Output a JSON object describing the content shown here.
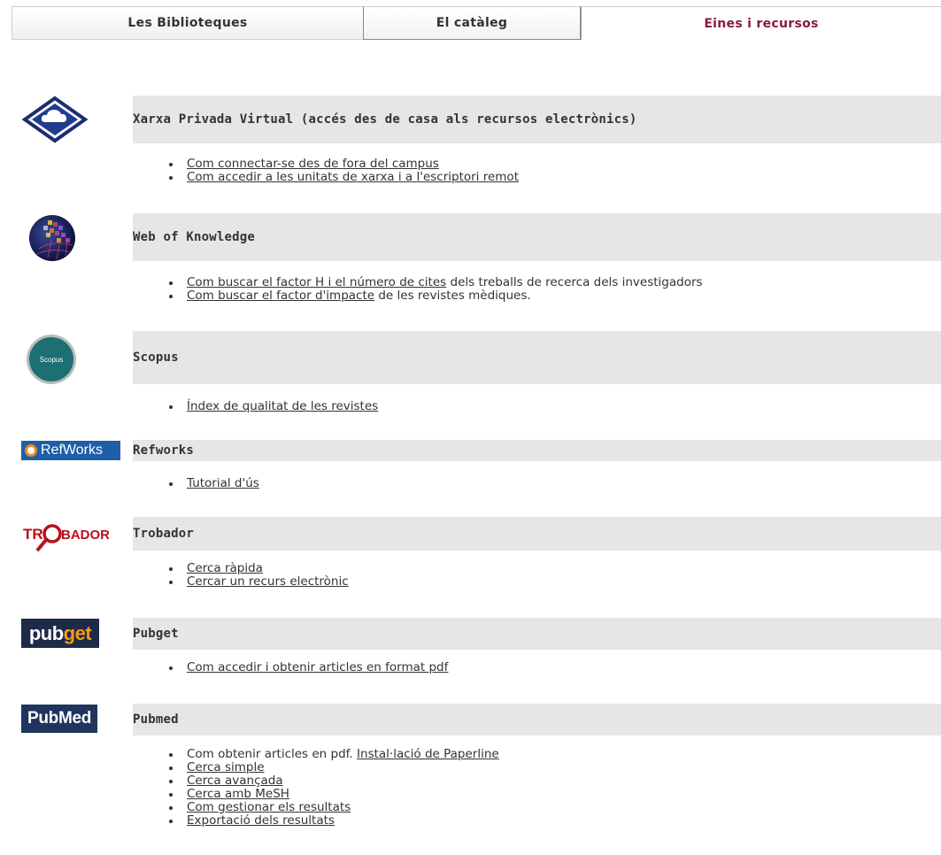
{
  "tabs": [
    {
      "label": "Les Biblioteques"
    },
    {
      "label": "El catàleg"
    },
    {
      "label": "Eines i recursos",
      "active": true
    }
  ],
  "colors": {
    "active_tab": "#8b1a3a",
    "bar_background": "#e6e6e6",
    "refworks_blue": "#1e5fa8",
    "trobador_red": "#b5121b",
    "pubget_navy": "#1d2a48",
    "pubget_orange": "#f49a1a",
    "pubmed_navy": "#20355e",
    "scopus_teal": "#1e6f73"
  },
  "sections": {
    "vpn": {
      "icon": "vpn-diamond-icon",
      "title": "Xarxa Privada Virtual (accés des de casa als recursos electrònics)",
      "items": [
        {
          "link": "Com connectar-se des de fora del campus"
        },
        {
          "link": "Com accedir a les unitats de xarxa i a l'escriptori remot"
        }
      ]
    },
    "wok": {
      "icon": "web-of-knowledge-globe-icon",
      "title": "Web of Knowledge",
      "items": [
        {
          "link": "Com buscar el factor H i el número de cites",
          "text": " dels treballs de recerca dels investigadors"
        },
        {
          "link": "Com buscar el factor d'impacte",
          "text": " de les revistes mèdiques."
        }
      ]
    },
    "scopus": {
      "icon": "scopus-logo-icon",
      "logo_text": "Scopus",
      "title": "Scopus",
      "items": [
        {
          "link": "Índex de qualitat de les revistes"
        }
      ]
    },
    "refworks": {
      "icon": "refworks-logo-icon",
      "logo_text": "RefWorks",
      "title": "Refworks",
      "items": [
        {
          "link": "Tutorial d'ús"
        }
      ]
    },
    "trobador": {
      "icon": "trobador-logo-icon",
      "logo_text_1": "TR",
      "logo_text_2": "BADOR",
      "title": "Trobador",
      "items": [
        {
          "link": "Cerca ràpida"
        },
        {
          "link": "Cercar un recurs electrònic"
        }
      ]
    },
    "pubget": {
      "icon": "pubget-logo-icon",
      "logo_text_1": "pub",
      "logo_text_2": "get",
      "title": "Pubget",
      "items": [
        {
          "link": "Com accedir i obtenir articles en format pdf"
        }
      ]
    },
    "pubmed": {
      "icon": "pubmed-logo-icon",
      "logo_text": "PubMed",
      "title": "Pubmed",
      "items": [
        {
          "text": "Com obtenir articles en pdf. ",
          "link": "Instal·lació de Paperline"
        },
        {
          "link": "Cerca simple"
        },
        {
          "link": "Cerca avançada"
        },
        {
          "link": "Cerca amb MeSH"
        },
        {
          "link": "Com gestionar els resultats"
        },
        {
          "link": "Exportació dels resultats"
        }
      ]
    }
  }
}
